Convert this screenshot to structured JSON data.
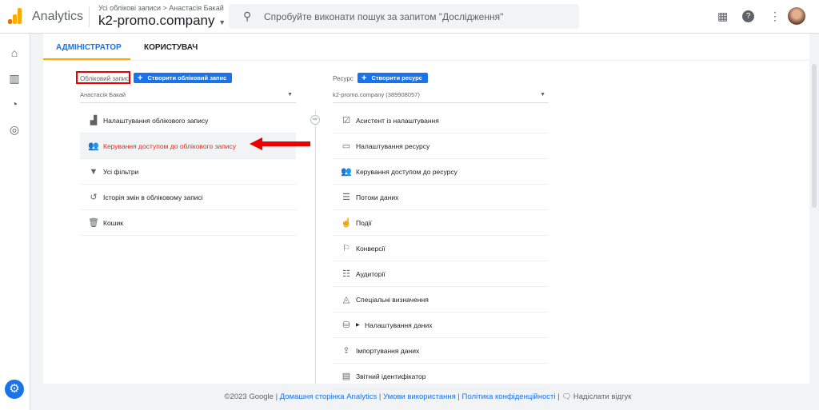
{
  "header": {
    "app_name": "Analytics",
    "breadcrumb": "Усі облікові записи > Анастасія Бакай",
    "account": "k2-promo.company",
    "search_placeholder": "Спробуйте виконати пошук за запитом \"Дослідження\""
  },
  "tabs": [
    {
      "label": "АДМІНІСТРАТОР",
      "active": true
    },
    {
      "label": "КОРИСТУВАЧ",
      "active": false
    }
  ],
  "account_col": {
    "heading": "Обліковий запис",
    "create_label": "Створити обліковий запис",
    "selected": "Анастасія Бакай",
    "items": [
      {
        "label": "Налаштування облікового запису",
        "icon": "building-icon"
      },
      {
        "label": "Керування доступом до облікового запису",
        "icon": "people-icon",
        "highlighted": true
      },
      {
        "label": "Усі фільтри",
        "icon": "filter-icon"
      },
      {
        "label": "Історія змін в обліковому записі",
        "icon": "history-icon"
      },
      {
        "label": "Кошик",
        "icon": "trash-icon"
      }
    ]
  },
  "property_col": {
    "heading": "Ресурс",
    "create_label": "Створити ресурс",
    "selected": "k2-promo.company (389908057)",
    "items": [
      {
        "label": "Асистент із налаштування",
        "icon": "checkbox-icon"
      },
      {
        "label": "Налаштування ресурсу",
        "icon": "window-icon"
      },
      {
        "label": "Керування доступом до ресурсу",
        "icon": "people-icon"
      },
      {
        "label": "Потоки даних",
        "icon": "streams-icon"
      },
      {
        "label": "Події",
        "icon": "touch-icon"
      },
      {
        "label": "Конверсії",
        "icon": "flag-icon"
      },
      {
        "label": "Аудиторії",
        "icon": "audience-icon"
      },
      {
        "label": "Спеціальні визначення",
        "icon": "shapes-icon"
      },
      {
        "label": "Налаштування даних",
        "icon": "database-icon"
      },
      {
        "label": "Імпортування даних",
        "icon": "upload-icon"
      },
      {
        "label": "Звітний ідентифікатор",
        "icon": "id-icon"
      }
    ]
  },
  "footer": {
    "copyright": "©2023 Google |",
    "home": "Домашня сторінка Analytics",
    "terms": "Умови використання",
    "privacy": "Політика конфіденційності",
    "feedback": "Надіслати відгук"
  },
  "colors": {
    "accent": "#1a73e8",
    "highlight": "#d93025",
    "tab_underline": "#f9ab00"
  }
}
